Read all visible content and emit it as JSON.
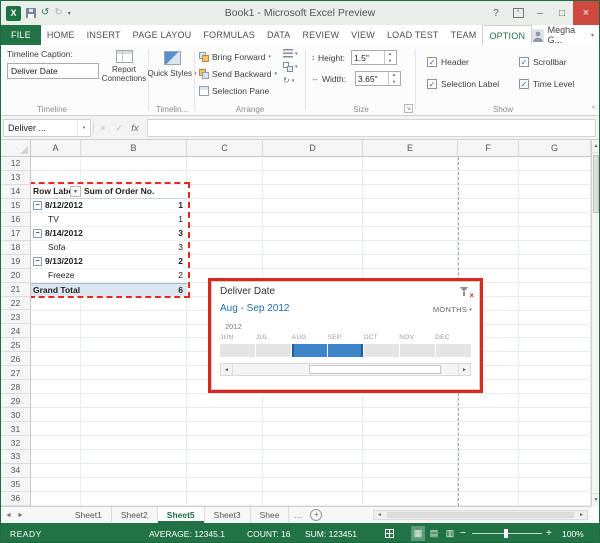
{
  "icons": {
    "excel_logo": "X",
    "undo": "↺",
    "redo": "↻",
    "qat_dropdown": "▾",
    "help": "?",
    "ribbon_options": "^",
    "minimize": "–",
    "restore": "□",
    "close": "×",
    "dropdown": "▾",
    "cancel": "×",
    "enter": "✓",
    "fx": "fx",
    "check": "✓",
    "up": "▲",
    "down": "▼",
    "left": "◄",
    "right": "►",
    "more_tabs": "…",
    "new_sheet": "+",
    "zoom_out": "−",
    "zoom_in": "+",
    "collapse_ribbon": "^",
    "filter_dropdown": "▼",
    "collapse_item": "−",
    "dialog_launcher": "↘",
    "height": "↕",
    "width": "↔",
    "rotate": "↻",
    "normal_view": "▦",
    "page_layout_view": "▤",
    "page_break_view": "▥"
  },
  "window": {
    "title": "Book1 - Microsoft Excel Preview"
  },
  "ribbon": {
    "tabs": [
      "FILE",
      "HOME",
      "INSERT",
      "PAGE LAYOU",
      "FORMULAS",
      "DATA",
      "REVIEW",
      "VIEW",
      "LOAD TEST",
      "TEAM",
      "OPTION"
    ],
    "active_tab": "OPTION",
    "user_name": "Megha G...",
    "timeline_group": {
      "caption_label": "Timeline Caption:",
      "caption_value": "Deliver Date",
      "report_connections": "Report Connections",
      "label": "Timeline"
    },
    "styles_group": {
      "button_label": "Quick Styles",
      "label": "Timelin..."
    },
    "arrange_group": {
      "items": [
        "Bring Forward",
        "Send Backward",
        "Selection Pane"
      ],
      "label": "Arrange"
    },
    "size_group": {
      "height_label": "Height:",
      "height_value": "1.5\"",
      "width_label": "Width:",
      "width_value": "3.65\"",
      "label": "Size"
    },
    "show_group": {
      "options": [
        {
          "label": "Header",
          "checked": true
        },
        {
          "label": "Scrollbar",
          "checked": true
        },
        {
          "label": "Selection Label",
          "checked": true
        },
        {
          "label": "Time Level",
          "checked": true
        }
      ],
      "label": "Show"
    }
  },
  "formula_bar": {
    "name_box": "Deliver ...",
    "formula_value": ""
  },
  "grid": {
    "columns": [
      "A",
      "B",
      "C",
      "D",
      "E",
      "F",
      "G"
    ],
    "first_row": 12,
    "last_row": 36,
    "pivot_table": {
      "rows": [
        {
          "type": "header",
          "a": "Row Labels",
          "b": "Sum of Order No."
        },
        {
          "type": "group",
          "a": "8/12/2012",
          "b": "1"
        },
        {
          "type": "item",
          "a": "TV",
          "b": "1"
        },
        {
          "type": "group",
          "a": "8/14/2012",
          "b": "3"
        },
        {
          "type": "item",
          "a": "Sofa",
          "b": "3"
        },
        {
          "type": "group",
          "a": "9/13/2012",
          "b": "2"
        },
        {
          "type": "item",
          "a": "Freeze",
          "b": "2"
        },
        {
          "type": "total",
          "a": "Grand Total",
          "b": "6"
        }
      ]
    }
  },
  "timeline": {
    "title": "Deliver Date",
    "selection_label": "Aug - Sep 2012",
    "period_label": "MONTHS",
    "year_label": "2012",
    "months": [
      "JUN",
      "JUL",
      "AUG",
      "SEP",
      "OCT",
      "NOV",
      "DEC"
    ],
    "selected_months": [
      "AUG",
      "SEP"
    ]
  },
  "sheet_bar": {
    "tabs": [
      "Sheet1",
      "Sheet2",
      "Sheet5",
      "Sheet3",
      "Shee"
    ],
    "active_tab": "Sheet5"
  },
  "status_bar": {
    "mode": "READY",
    "average": "AVERAGE: 12345.1",
    "count": "COUNT: 16",
    "sum": "SUM: 123451",
    "zoom": "100%"
  }
}
